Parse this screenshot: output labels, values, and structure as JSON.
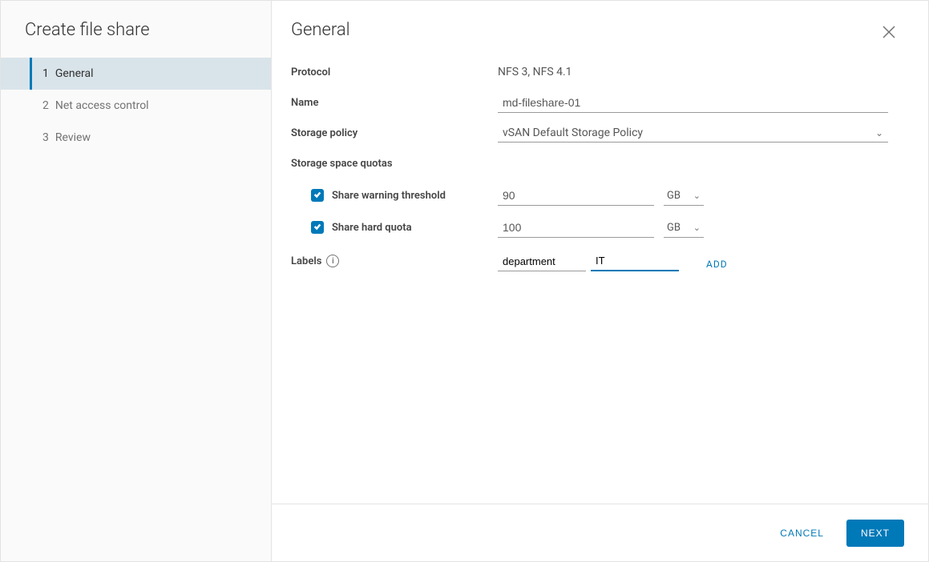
{
  "sidebar": {
    "title": "Create file share",
    "steps": [
      {
        "num": "1",
        "label": "General"
      },
      {
        "num": "2",
        "label": "Net access control"
      },
      {
        "num": "3",
        "label": "Review"
      }
    ]
  },
  "main": {
    "title": "General",
    "protocol_label": "Protocol",
    "protocol_value": "NFS 3, NFS 4.1",
    "name_label": "Name",
    "name_value": "md-fileshare-01",
    "policy_label": "Storage policy",
    "policy_value": "vSAN Default Storage Policy",
    "quota_header": "Storage space quotas",
    "warn_label": "Share warning threshold",
    "warn_value": "90",
    "warn_unit": "GB",
    "hard_label": "Share hard quota",
    "hard_value": "100",
    "hard_unit": "GB",
    "labels_label": "Labels",
    "label_key": "department",
    "label_val": "IT",
    "add": "ADD"
  },
  "footer": {
    "cancel": "CANCEL",
    "next": "NEXT"
  }
}
